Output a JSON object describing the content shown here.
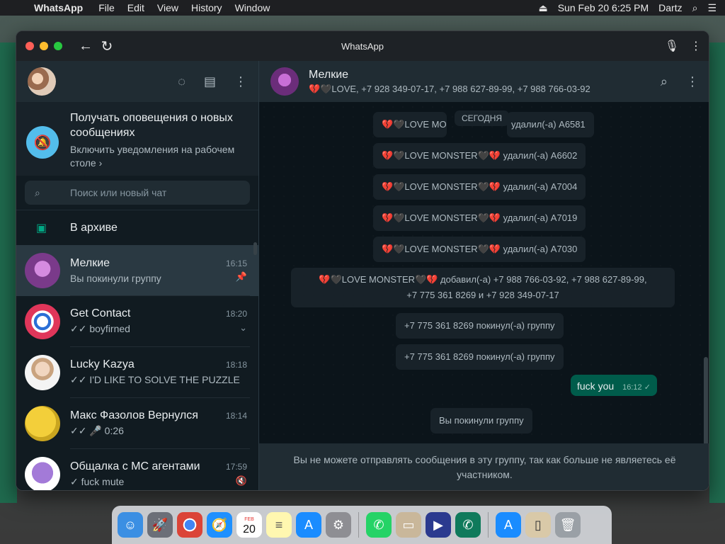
{
  "menubar": {
    "app_name": "WhatsApp",
    "items": [
      "File",
      "Edit",
      "View",
      "History",
      "Window"
    ],
    "datetime": "Sun Feb 20  6:25 PM",
    "user": "Dartz"
  },
  "window": {
    "title": "WhatsApp"
  },
  "sidebar": {
    "notification": {
      "title": "Получать оповещения о новых сообщениях",
      "subtitle": "Включить уведомления на рабочем столе ›"
    },
    "search": {
      "placeholder": "Поиск или новый чат"
    },
    "archive_label": "В архиве",
    "chats": [
      {
        "name": "Мелкие",
        "time": "16:15",
        "preview": "Вы покинули группу",
        "meta": "📌"
      },
      {
        "name": "Get Contact",
        "time": "18:20",
        "preview": "✓✓ boyfirned",
        "meta": "⌄"
      },
      {
        "name": "Lucky Kazya",
        "time": "18:18",
        "preview": "✓✓ I'D LIKE TO SOLVE THE PUZZLE",
        "meta": ""
      },
      {
        "name": "Макс Фазолов Вернулся",
        "time": "18:14",
        "preview": "✓✓ 🎤 0:26",
        "meta": ""
      },
      {
        "name": "Общалка с МС агентами",
        "time": "17:59",
        "preview": "✓ fuck mute",
        "meta": "🔇"
      }
    ]
  },
  "conversation": {
    "name": "Мелкие",
    "members": "💔🖤LOVE, +7 928 349-07-17, +7 988 627-89-99, +7 988 766-03-92",
    "date_chip": "СЕГОДНЯ",
    "system_messages": [
      "💔🖤LOVE MON",
      "удалил(-а) A6581",
      "💔🖤LOVE MONSTER🖤💔 удалил(-а) A6602",
      "💔🖤LOVE MONSTER🖤💔 удалил(-а) A7004",
      "💔🖤LOVE MONSTER🖤💔 удалил(-а) A7019",
      "💔🖤LOVE MONSTER🖤💔 удалил(-а) A7030",
      "💔🖤LOVE MONSTER🖤💔 добавил(-а) +7 988 766-03-92, +7 988 627-89-99,",
      "+7 775 361 8269 и +7 928 349-07-17",
      "+7 775 361 8269 покинул(-а) группу",
      "+7 775 361 8269 покинул(-а) группу"
    ],
    "outgoing": {
      "text": "fuck you",
      "time": "16:12 ✓"
    },
    "left_notice": "Вы покинули группу",
    "footer": "Вы не можете отправлять сообщения в эту группу, так как больше не являетесь её участником."
  },
  "dock": {
    "calendar_month": "FEB",
    "calendar_day": "20"
  },
  "colors": {
    "accent": "#00a884",
    "panel": "#202c33",
    "background": "#0b141a",
    "outgoing_bubble": "#005c4b"
  }
}
